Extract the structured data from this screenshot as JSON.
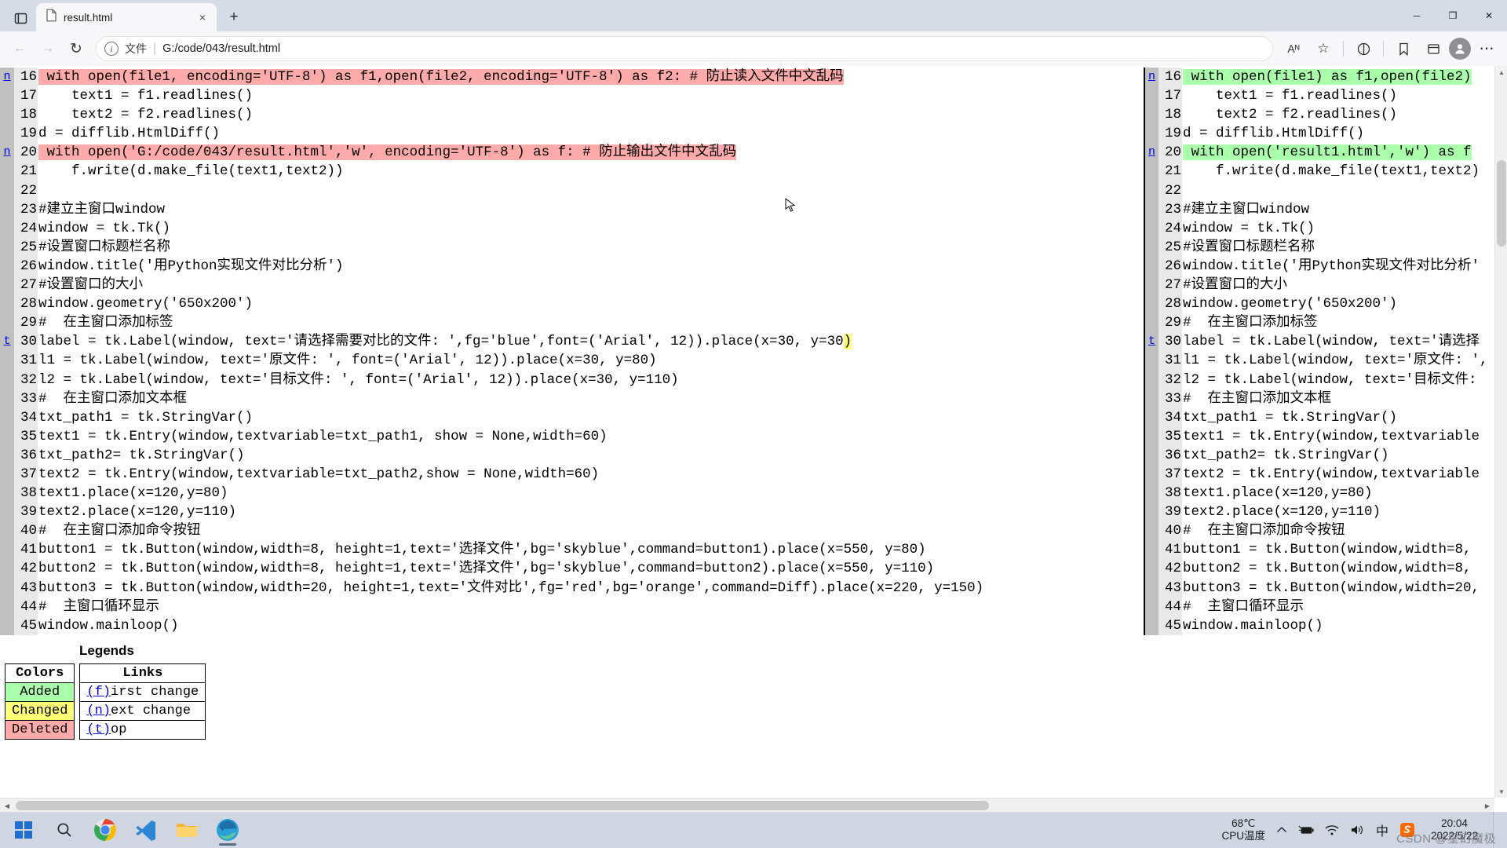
{
  "browser": {
    "tab": {
      "title": "result.html",
      "icon": "file-icon",
      "close_icon": "×"
    },
    "new_tab_icon": "+",
    "tab_actions_icon": "tab-actions-icon",
    "window_controls": {
      "minimize": "─",
      "maximize": "❐",
      "close": "✕"
    },
    "nav": {
      "back_icon": "←",
      "forward_icon": "→",
      "refresh_icon": "↻",
      "read_aloud_icon": "Aᴺ",
      "favorite_icon": "☆",
      "split_icon": "split-screen-icon",
      "collections_icon": "collections-icon",
      "favorites_bar_icon": "favorites-icon",
      "profile_icon": "profile-icon",
      "settings_icon": "⋯"
    },
    "omnibox": {
      "info_icon": "i",
      "scheme_label": "文件",
      "separator": "|",
      "url": "G:/code/043/result.html"
    }
  },
  "diff": {
    "left": [
      {
        "next": "n",
        "no": "16",
        "text": "with open(file1, encoding='UTF-8') as f1,open(file2, encoding='UTF-8') as f2: # 防止读入文件中文乱码",
        "state": "sub"
      },
      {
        "next": "",
        "no": "17",
        "text": "    text1 = f1.readlines()",
        "state": "none"
      },
      {
        "next": "",
        "no": "18",
        "text": "    text2 = f2.readlines()",
        "state": "none"
      },
      {
        "next": "",
        "no": "19",
        "text": "d = difflib.HtmlDiff()",
        "state": "none"
      },
      {
        "next": "n",
        "no": "20",
        "text": "with open('G:/code/043/result.html','w', encoding='UTF-8') as f: # 防止输出文件中文乱码",
        "state": "sub"
      },
      {
        "next": "",
        "no": "21",
        "text": "    f.write(d.make_file(text1,text2))",
        "state": "none"
      },
      {
        "next": "",
        "no": "22",
        "text": "",
        "state": "none"
      },
      {
        "next": "",
        "no": "23",
        "text": "#建立主窗口window",
        "state": "none"
      },
      {
        "next": "",
        "no": "24",
        "text": "window = tk.Tk()",
        "state": "none"
      },
      {
        "next": "",
        "no": "25",
        "text": "#设置窗口标题栏名称",
        "state": "none"
      },
      {
        "next": "",
        "no": "26",
        "text": "window.title('用Python实现文件对比分析')",
        "state": "none"
      },
      {
        "next": "",
        "no": "27",
        "text": "#设置窗口的大小",
        "state": "none"
      },
      {
        "next": "",
        "no": "28",
        "text": "window.geometry('650x200')",
        "state": "none"
      },
      {
        "next": "",
        "no": "29",
        "text": "#  在主窗口添加标签",
        "state": "none"
      },
      {
        "next": "t",
        "no": "30",
        "text": "label = tk.Label(window, text='请选择需要对比的文件: ',fg='blue',font=('Arial', 12)).place(x=30, y=30)",
        "state": "chg-tail"
      },
      {
        "next": "",
        "no": "31",
        "text": "l1 = tk.Label(window, text='原文件: ', font=('Arial', 12)).place(x=30, y=80)",
        "state": "none"
      },
      {
        "next": "",
        "no": "32",
        "text": "l2 = tk.Label(window, text='目标文件: ', font=('Arial', 12)).place(x=30, y=110)",
        "state": "none"
      },
      {
        "next": "",
        "no": "33",
        "text": "#  在主窗口添加文本框",
        "state": "none"
      },
      {
        "next": "",
        "no": "34",
        "text": "txt_path1 = tk.StringVar()",
        "state": "none"
      },
      {
        "next": "",
        "no": "35",
        "text": "text1 = tk.Entry(window,textvariable=txt_path1, show = None,width=60)",
        "state": "none"
      },
      {
        "next": "",
        "no": "36",
        "text": "txt_path2= tk.StringVar()",
        "state": "none"
      },
      {
        "next": "",
        "no": "37",
        "text": "text2 = tk.Entry(window,textvariable=txt_path2,show = None,width=60)",
        "state": "none"
      },
      {
        "next": "",
        "no": "38",
        "text": "text1.place(x=120,y=80)",
        "state": "none"
      },
      {
        "next": "",
        "no": "39",
        "text": "text2.place(x=120,y=110)",
        "state": "none"
      },
      {
        "next": "",
        "no": "40",
        "text": "#  在主窗口添加命令按钮",
        "state": "none"
      },
      {
        "next": "",
        "no": "41",
        "text": "button1 = tk.Button(window,width=8, height=1,text='选择文件',bg='skyblue',command=button1).place(x=550, y=80)",
        "state": "none"
      },
      {
        "next": "",
        "no": "42",
        "text": "button2 = tk.Button(window,width=8, height=1,text='选择文件',bg='skyblue',command=button2).place(x=550, y=110)",
        "state": "none"
      },
      {
        "next": "",
        "no": "43",
        "text": "button3 = tk.Button(window,width=20, height=1,text='文件对比',fg='red',bg='orange',command=Diff).place(x=220, y=150)",
        "state": "none"
      },
      {
        "next": "",
        "no": "44",
        "text": "#  主窗口循环显示",
        "state": "none"
      },
      {
        "next": "",
        "no": "45",
        "text": "window.mainloop()",
        "state": "none"
      }
    ],
    "right": [
      {
        "next": "n",
        "no": "16",
        "text": "with open(file1) as f1,open(file2)",
        "state": "add"
      },
      {
        "next": "",
        "no": "17",
        "text": "    text1 = f1.readlines()",
        "state": "none"
      },
      {
        "next": "",
        "no": "18",
        "text": "    text2 = f2.readlines()",
        "state": "none"
      },
      {
        "next": "",
        "no": "19",
        "text": "d = difflib.HtmlDiff()",
        "state": "none"
      },
      {
        "next": "n",
        "no": "20",
        "text": "with open('result1.html','w') as f",
        "state": "add"
      },
      {
        "next": "",
        "no": "21",
        "text": "    f.write(d.make_file(text1,text2)",
        "state": "none"
      },
      {
        "next": "",
        "no": "22",
        "text": "",
        "state": "none"
      },
      {
        "next": "",
        "no": "23",
        "text": "#建立主窗口window",
        "state": "none"
      },
      {
        "next": "",
        "no": "24",
        "text": "window = tk.Tk()",
        "state": "none"
      },
      {
        "next": "",
        "no": "25",
        "text": "#设置窗口标题栏名称",
        "state": "none"
      },
      {
        "next": "",
        "no": "26",
        "text": "window.title('用Python实现文件对比分析'",
        "state": "none"
      },
      {
        "next": "",
        "no": "27",
        "text": "#设置窗口的大小",
        "state": "none"
      },
      {
        "next": "",
        "no": "28",
        "text": "window.geometry('650x200')",
        "state": "none"
      },
      {
        "next": "",
        "no": "29",
        "text": "#  在主窗口添加标签",
        "state": "none"
      },
      {
        "next": "t",
        "no": "30",
        "text": "label = tk.Label(window, text='请选择",
        "state": "none"
      },
      {
        "next": "",
        "no": "31",
        "text": "l1 = tk.Label(window, text='原文件: ',",
        "state": "none"
      },
      {
        "next": "",
        "no": "32",
        "text": "l2 = tk.Label(window, text='目标文件:",
        "state": "none"
      },
      {
        "next": "",
        "no": "33",
        "text": "#  在主窗口添加文本框",
        "state": "none"
      },
      {
        "next": "",
        "no": "34",
        "text": "txt_path1 = tk.StringVar()",
        "state": "none"
      },
      {
        "next": "",
        "no": "35",
        "text": "text1 = tk.Entry(window,textvariable",
        "state": "none"
      },
      {
        "next": "",
        "no": "36",
        "text": "txt_path2= tk.StringVar()",
        "state": "none"
      },
      {
        "next": "",
        "no": "37",
        "text": "text2 = tk.Entry(window,textvariable",
        "state": "none"
      },
      {
        "next": "",
        "no": "38",
        "text": "text1.place(x=120,y=80)",
        "state": "none"
      },
      {
        "next": "",
        "no": "39",
        "text": "text2.place(x=120,y=110)",
        "state": "none"
      },
      {
        "next": "",
        "no": "40",
        "text": "#  在主窗口添加命令按钮",
        "state": "none"
      },
      {
        "next": "",
        "no": "41",
        "text": "button1 = tk.Button(window,width=8,",
        "state": "none"
      },
      {
        "next": "",
        "no": "42",
        "text": "button2 = tk.Button(window,width=8,",
        "state": "none"
      },
      {
        "next": "",
        "no": "43",
        "text": "button3 = tk.Button(window,width=20,",
        "state": "none"
      },
      {
        "next": "",
        "no": "44",
        "text": "#  主窗口循环显示",
        "state": "none"
      },
      {
        "next": "",
        "no": "45",
        "text": "window.mainloop()",
        "state": "none"
      }
    ]
  },
  "legends": {
    "title": "Legends",
    "colors_header": "Colors",
    "links_header": "Links",
    "colors": [
      {
        "label": "Added",
        "color": "#aaffaa"
      },
      {
        "label": "Changed",
        "color": "#ffff77"
      },
      {
        "label": "Deleted",
        "color": "#ffaaaa"
      }
    ],
    "links": [
      {
        "key": "(f)",
        "label": "irst change"
      },
      {
        "key": "(n)",
        "label": "ext change"
      },
      {
        "key": "(t)",
        "label": "op"
      }
    ]
  },
  "taskbar": {
    "start_icon": "windows-start-icon",
    "search_icon": "search-icon",
    "apps": [
      {
        "name": "chrome-icon"
      },
      {
        "name": "vscode-icon"
      },
      {
        "name": "file-explorer-icon"
      },
      {
        "name": "edge-icon"
      }
    ],
    "temp_value": "68℃",
    "temp_label": "CPU温度",
    "tray": {
      "chevron_icon": "⌃",
      "battery_icon": "battery-icon",
      "wifi_icon": "wifi-icon",
      "volume_icon": "volume-icon",
      "ime_icon": "中",
      "sogou_icon": "S"
    },
    "time": "20:04",
    "date": "2022/5/22",
    "watermark": "CSDN @星幻魔极"
  }
}
